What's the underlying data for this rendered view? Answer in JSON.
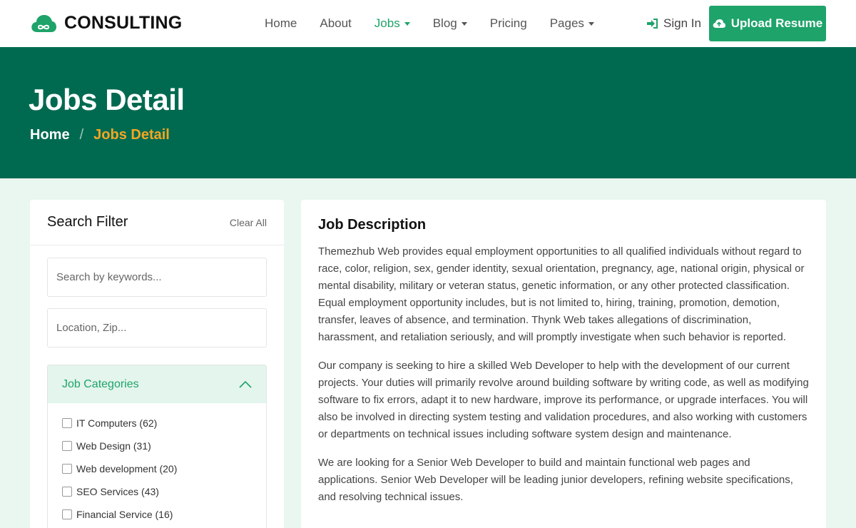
{
  "header": {
    "logo_text": "CONSULTING",
    "nav": [
      {
        "label": "Home",
        "active": false,
        "dropdown": false
      },
      {
        "label": "About",
        "active": false,
        "dropdown": false
      },
      {
        "label": "Jobs",
        "active": true,
        "dropdown": true
      },
      {
        "label": "Blog",
        "active": false,
        "dropdown": true
      },
      {
        "label": "Pricing",
        "active": false,
        "dropdown": false
      },
      {
        "label": "Pages",
        "active": false,
        "dropdown": true
      }
    ],
    "signin_label": "Sign In",
    "upload_label": "Upload Resume"
  },
  "hero": {
    "title": "Jobs Detail",
    "breadcrumb_home": "Home",
    "breadcrumb_sep": "/",
    "breadcrumb_current": "Jobs Detail"
  },
  "sidebar": {
    "title": "Search Filter",
    "clear_label": "Clear All",
    "keywords_placeholder": "Search by keywords...",
    "location_placeholder": "Location, Zip...",
    "categories_title": "Job Categories",
    "categories": [
      "IT Computers (62)",
      "Web Design (31)",
      "Web development (20)",
      "SEO Services (43)",
      "Financial Service (16)"
    ]
  },
  "main": {
    "title": "Job Description",
    "paragraphs": [
      "Themezhub Web provides equal employment opportunities to all qualified individuals without regard to race, color, religion, sex, gender identity, sexual orientation, pregnancy, age, national origin, physical or mental disability, military or veteran status, genetic information, or any other protected classification. Equal employment opportunity includes, but is not limited to, hiring, training, promotion, demotion, transfer, leaves of absence, and termination. Thynk Web takes allegations of discrimination, harassment, and retaliation seriously, and will promptly investigate when such behavior is reported.",
      "Our company is seeking to hire a skilled Web Developer to help with the development of our current projects. Your duties will primarily revolve around building software by writing code, as well as modifying software to fix errors, adapt it to new hardware, improve its performance, or upgrade interfaces. You will also be involved in directing system testing and validation procedures, and also working with customers or departments on technical issues including software system design and maintenance.",
      "We are looking for a Senior Web Developer to build and maintain functional web pages and applications. Senior Web Developer will be leading junior developers, refining website specifications, and resolving technical issues."
    ]
  },
  "colors": {
    "brand": "#1ea36a",
    "hero_bg": "#006a51",
    "breadcrumb_accent": "#f5a623",
    "page_bg": "#eaf6f0"
  }
}
